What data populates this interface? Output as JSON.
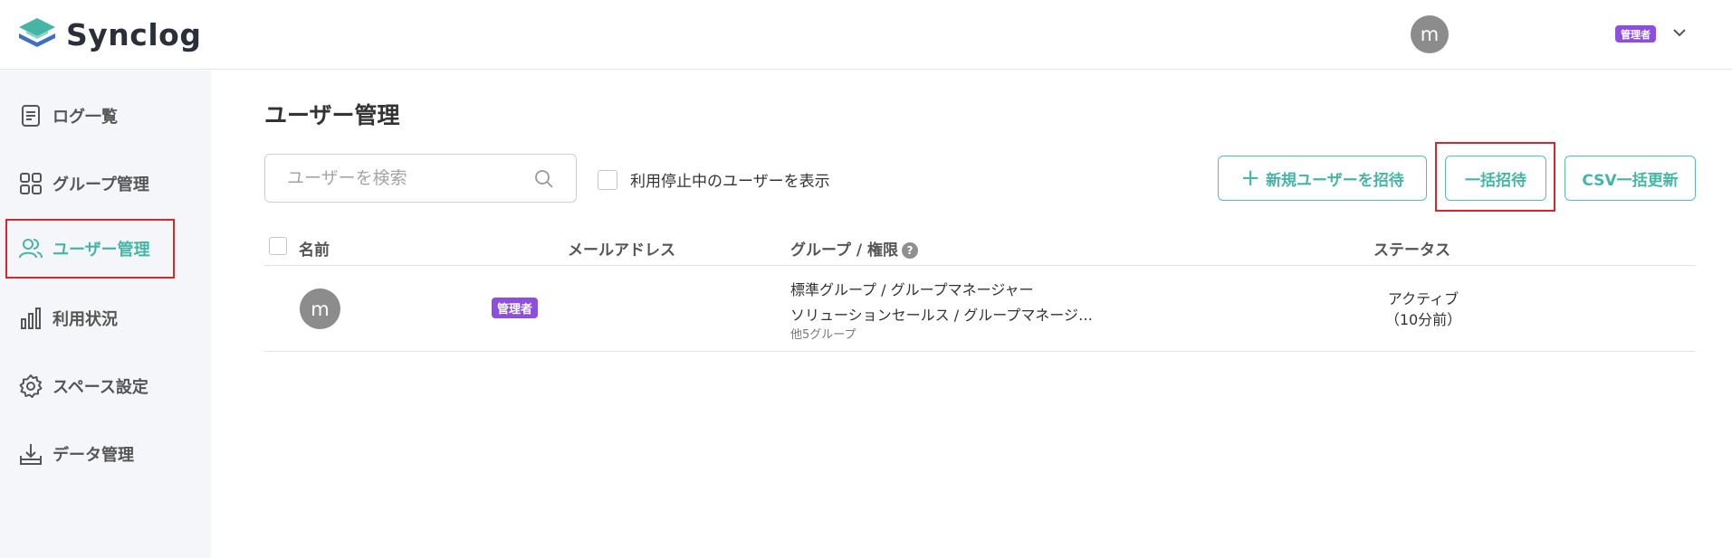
{
  "app": {
    "name": "Synclog"
  },
  "header": {
    "avatar_initial": "m",
    "role_badge": "管理者"
  },
  "sidebar": {
    "items": [
      {
        "label": "ログ一覧",
        "icon": "document-list-icon"
      },
      {
        "label": "グループ管理",
        "icon": "grid-icon"
      },
      {
        "label": "ユーザー管理",
        "icon": "users-icon",
        "active": true
      },
      {
        "label": "利用状況",
        "icon": "bar-chart-icon"
      },
      {
        "label": "スペース設定",
        "icon": "gear-icon"
      },
      {
        "label": "データ管理",
        "icon": "download-tray-icon"
      }
    ]
  },
  "main": {
    "title": "ユーザー管理",
    "search": {
      "placeholder": "ユーザーを検索",
      "value": ""
    },
    "show_inactive_label": "利用停止中のユーザーを表示",
    "buttons": {
      "new_user": "新規ユーザーを招待",
      "bulk_invite": "一括招待",
      "csv_update": "CSV一括更新"
    },
    "table": {
      "columns": {
        "name": "名前",
        "email": "メールアドレス",
        "group_role": "グループ / 権限",
        "status": "ステータス"
      },
      "rows": [
        {
          "avatar_initial": "m",
          "role_badge": "管理者",
          "groups": [
            "標準グループ / グループマネージャー",
            "ソリューションセールス / グループマネージ…"
          ],
          "more_groups": "他5グループ",
          "status_line1": "アクティブ",
          "status_line2": "（10分前）"
        }
      ]
    }
  },
  "colors": {
    "accent": "#45b5a6",
    "badge": "#8e4ee0",
    "highlight": "#d9262e",
    "sidebar_bg": "#f4f6f9"
  }
}
